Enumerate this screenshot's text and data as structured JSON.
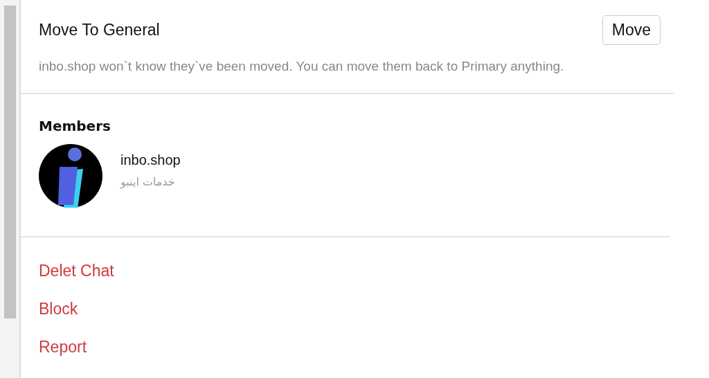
{
  "move_section": {
    "title": "Move To General",
    "button": "Move",
    "description": "inbo.shop won`t know they`ve been moved. You can move them back to Primary anything."
  },
  "members": {
    "heading": "Members",
    "items": [
      {
        "name": "inbo.shop",
        "subtitle": "خدمات اینبو"
      }
    ]
  },
  "actions": [
    {
      "label": "Delet Chat"
    },
    {
      "label": "Block"
    },
    {
      "label": "Report"
    }
  ]
}
